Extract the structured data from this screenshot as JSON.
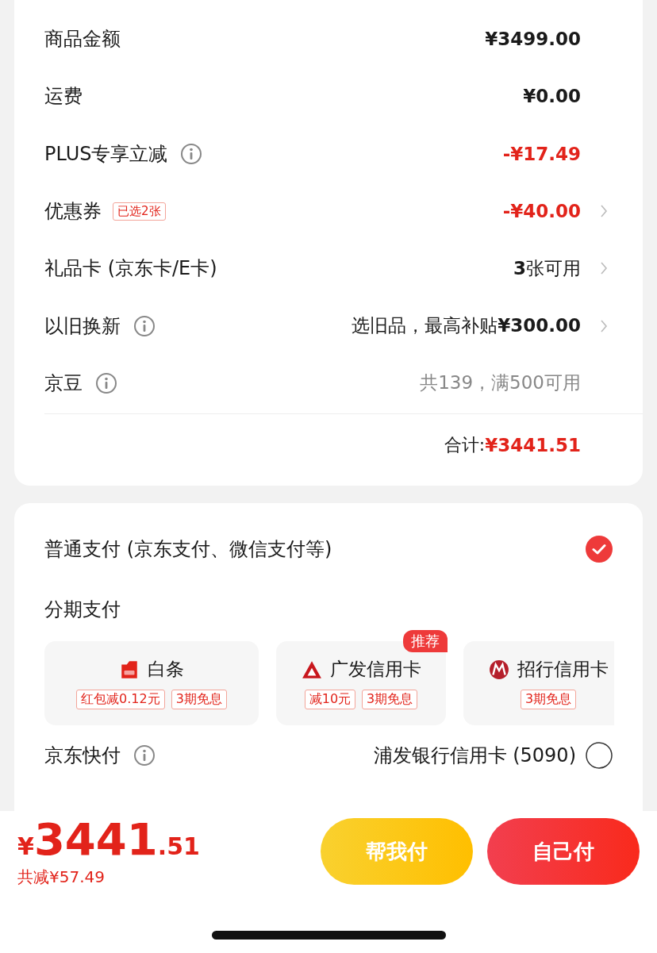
{
  "summary": {
    "rows": [
      {
        "label": "商品金额",
        "info": false,
        "value": "¥3499.00",
        "kind": "strong",
        "chevron": false
      },
      {
        "label": "运费",
        "info": false,
        "value": "¥0.00",
        "kind": "strong",
        "chevron": false
      },
      {
        "label": "PLUS专享立减",
        "info": true,
        "value": "-¥17.49",
        "kind": "discount",
        "chevron": false
      },
      {
        "label": "优惠券",
        "info": false,
        "tag": "已选2张",
        "value": "-¥40.00",
        "kind": "discount",
        "chevron": true
      },
      {
        "label": "礼品卡 (京东卡/E卡)",
        "info": false,
        "value": "**3**张可用",
        "kind": "normal",
        "chevron": true
      },
      {
        "label": "以旧换新",
        "info": true,
        "value": "选旧品，最高补贴**¥300.00**",
        "kind": "normal",
        "chevron": true
      },
      {
        "label": "京豆",
        "info": true,
        "value": "共139，满500可用",
        "kind": "muted",
        "chevron": false
      }
    ],
    "total_label": "合计:",
    "total_value": "¥3441.51"
  },
  "payment": {
    "standard": {
      "label": "普通支付 (京东支付、微信支付等)",
      "selected": true
    },
    "installment_title": "分期支付",
    "installment_options": [
      {
        "kind": "baitiao",
        "name": "白条",
        "tags": [
          "红包减0.12元",
          "3期免息"
        ]
      },
      {
        "kind": "triangle",
        "name": "广发信用卡",
        "badge": "推荐",
        "tags": [
          "减10元",
          "3期免息"
        ]
      },
      {
        "kind": "circle",
        "name": "招行信用卡",
        "tags": [
          "3期免息"
        ]
      }
    ],
    "quick_pay": {
      "label": "京东快付",
      "card": "浦发银行信用卡 (5090)",
      "selected": false
    }
  },
  "footer": {
    "currency": "¥",
    "amount": "3441",
    "cents": ".51",
    "saved": "共减¥57.49",
    "buttons": [
      {
        "label": "帮我付",
        "kind": "friend"
      },
      {
        "label": "自己付",
        "kind": "self"
      }
    ]
  }
}
